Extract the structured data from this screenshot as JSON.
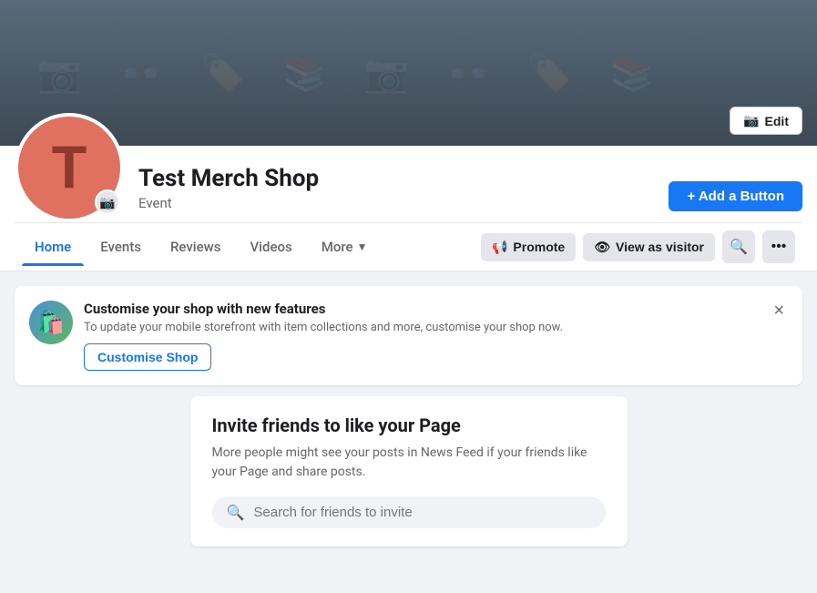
{
  "cover": {
    "edit_label": "Edit",
    "icons": [
      "📷",
      "👓",
      "🏷️",
      "📚",
      "📷",
      "👓",
      "🏷️",
      "📚"
    ]
  },
  "profile": {
    "name": "Test Merch Shop",
    "type": "Event",
    "avatar_letter": "T",
    "add_button_label": "+ Add a Button"
  },
  "nav": {
    "tabs": [
      {
        "label": "Home",
        "active": true
      },
      {
        "label": "Events",
        "active": false
      },
      {
        "label": "Reviews",
        "active": false
      },
      {
        "label": "Videos",
        "active": false
      },
      {
        "label": "More",
        "active": false,
        "has_arrow": true
      }
    ],
    "actions": {
      "promote_label": "Promote",
      "view_as_visitor_label": "View as visitor"
    }
  },
  "notification": {
    "title": "Customise your shop with new features",
    "description": "To update your mobile storefront with item collections and more, customise your shop now.",
    "action_label": "Customise Shop"
  },
  "invite": {
    "title": "Invite friends to like your Page",
    "description": "More people might see your posts in News Feed if your friends like your Page and share posts.",
    "search_placeholder": "Search for friends to invite"
  }
}
